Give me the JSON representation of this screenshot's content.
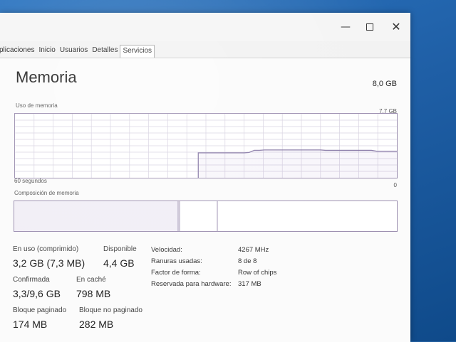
{
  "tabs": [
    "plicaciones",
    "Inicio",
    "Usuarios",
    "Detalles",
    "Servicios"
  ],
  "window_controls": {
    "minimize": "—",
    "close": "✕"
  },
  "icons": {
    "minimize": "minimize-icon",
    "maximize": "maximize-icon",
    "close": "close-icon"
  },
  "memory": {
    "title": "Memoria",
    "total": "8,0 GB",
    "usage_label": "Uso de memoria",
    "graph_max": "7,7 GB",
    "graph_time_label": "60 segundos",
    "graph_min": "0",
    "composition_label": "Composición de memoria",
    "usage_history_gb": [
      0,
      0,
      0,
      0,
      0,
      0,
      0,
      0,
      0,
      0,
      0,
      0,
      0,
      0,
      0,
      0,
      0,
      0,
      0,
      0,
      0,
      0,
      0,
      0,
      0,
      0,
      0,
      0,
      0,
      0,
      0,
      0,
      0,
      0,
      0,
      0,
      3.0,
      3.0,
      3.0,
      3.0,
      3.0,
      3.0,
      3.0,
      3.0,
      3.0,
      3.0,
      3.05,
      3.3,
      3.3,
      3.35,
      3.35,
      3.35,
      3.35,
      3.35,
      3.35,
      3.35,
      3.35,
      3.35,
      3.35,
      3.35,
      3.35,
      3.3,
      3.3,
      3.3,
      3.3,
      3.3,
      3.3,
      3.3,
      3.3,
      3.3,
      3.3,
      3.2,
      3.2,
      3.2,
      3.2,
      3.2
    ]
  },
  "stats": {
    "in_use_label": "En uso (comprimido)",
    "in_use_value": "3,2 GB (7,3 MB)",
    "available_label": "Disponible",
    "available_value": "4,4 GB",
    "committed_label": "Confirmada",
    "committed_value": "3,3/9,6 GB",
    "cached_label": "En caché",
    "cached_value": "798 MB",
    "paged_label": "Bloque paginado",
    "paged_value": "174 MB",
    "nonpaged_label": "Bloque no paginado",
    "nonpaged_value": "282 MB"
  },
  "specs": {
    "speed_label": "Velocidad:",
    "speed_value": "4267 MHz",
    "slots_label": "Ranuras usadas:",
    "slots_value": "8 de 8",
    "form_label": "Factor de forma:",
    "form_value": "Row of chips",
    "reserved_label": "Reservada para hardware:",
    "reserved_value": "317 MB"
  },
  "colors": {
    "line": "#8a7ca8",
    "grid": "#d6d1e0",
    "border": "#9c8fb0"
  }
}
